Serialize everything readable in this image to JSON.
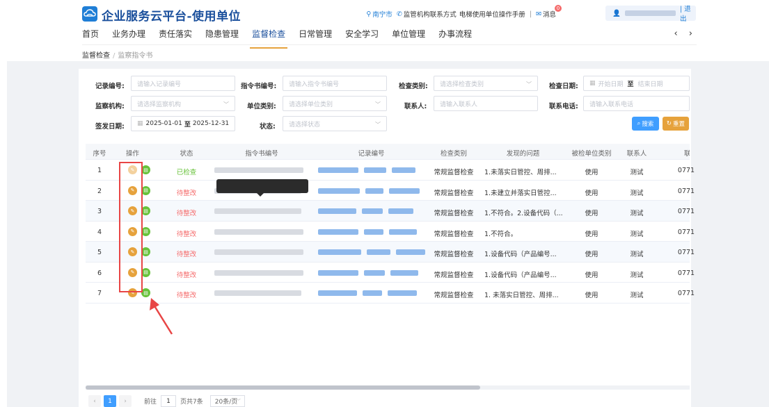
{
  "header": {
    "app_title": "企业服务云平台-使用单位",
    "location": "南宁市",
    "contact_link": "监管机构联系方式",
    "manual_link": "电梯使用单位操作手册",
    "separator": "|",
    "messages_label": "消息",
    "messages_count": "0",
    "logout_label": "| 退出"
  },
  "nav": {
    "items": [
      "首页",
      "业务办理",
      "责任落实",
      "隐患管理",
      "监督检查",
      "日常管理",
      "安全学习",
      "单位管理",
      "办事流程"
    ],
    "active_index": 4,
    "arrows": "‹ ›"
  },
  "breadcrumb": {
    "root": "监督检查",
    "separator": "/",
    "current": "监察指令书"
  },
  "filters": {
    "record_no_label": "记录编号:",
    "record_no_placeholder": "请输入记录编号",
    "order_no_label": "指令书编号:",
    "order_no_placeholder": "请输入指令书编号",
    "check_type_label": "检查类别:",
    "check_type_placeholder": "请选择检查类别",
    "check_date_label": "检查日期:",
    "check_date_start": "开始日期",
    "check_date_to": "至",
    "check_date_end": "结束日期",
    "agency_label": "监察机构:",
    "agency_placeholder": "请选择监察机构",
    "unit_type_label": "单位类别:",
    "unit_type_placeholder": "请选择单位类别",
    "contact_label": "联系人:",
    "contact_placeholder": "请输入联系人",
    "phone_label": "联系电话:",
    "phone_placeholder": "请输入联系电话",
    "issue_date_label": "签发日期:",
    "issue_date_start": "2025-01-01",
    "issue_date_to": "至",
    "issue_date_end": "2025-12-31",
    "status_label": "状态:",
    "status_placeholder": "请选择状态",
    "search_button": "搜索",
    "reset_button": "重置"
  },
  "table": {
    "columns": [
      "序号",
      "操作",
      "状态",
      "指令书编号",
      "记录编号",
      "检查类别",
      "发现的问题",
      "被检单位类别",
      "联系人",
      "联"
    ],
    "rows": [
      {
        "index": "1",
        "status": "已检查",
        "status_kind": "done",
        "check_type": "常规监督检查",
        "issue": "1.未落实日管控、周排...",
        "unit_type": "使用",
        "contact": "测试",
        "phone": "0771"
      },
      {
        "index": "2",
        "status": "待整改",
        "status_kind": "todo",
        "check_type": "常规监督检查",
        "issue": "1.未建立并落实日管控...",
        "unit_type": "使用",
        "contact": "测试",
        "phone": "0771"
      },
      {
        "index": "3",
        "status": "待整改",
        "status_kind": "todo",
        "check_type": "常规监督检查",
        "issue": "1.不符合。2.设备代码（...",
        "unit_type": "使用",
        "contact": "测试",
        "phone": "0771"
      },
      {
        "index": "4",
        "status": "待整改",
        "status_kind": "todo",
        "check_type": "常规监督检查",
        "issue": "1.不符合。",
        "unit_type": "使用",
        "contact": "测试",
        "phone": "0771"
      },
      {
        "index": "5",
        "status": "待整改",
        "status_kind": "todo",
        "check_type": "常规监督检查",
        "issue": "1.设备代码（产品编号...",
        "unit_type": "使用",
        "contact": "测试",
        "phone": "0771"
      },
      {
        "index": "6",
        "status": "待整改",
        "status_kind": "todo",
        "check_type": "常规监督检查",
        "issue": "1.设备代码（产品编号...",
        "unit_type": "使用",
        "contact": "测试",
        "phone": "0771"
      },
      {
        "index": "7",
        "status": "待整改",
        "status_kind": "todo",
        "check_type": "常规监督检查",
        "issue": "1. 未落实日管控、周排...",
        "unit_type": "使用",
        "contact": "测试",
        "phone": "0771"
      }
    ]
  },
  "pagination": {
    "current_page": "1",
    "goto_label": "前往",
    "goto_value": "1",
    "total_label": "页共7条",
    "page_size": "20条/页"
  },
  "colors": {
    "primary": "#409eff",
    "warning": "#e6a23c",
    "success": "#67c23a",
    "danger": "#f56c6c",
    "annotation": "#e84545"
  }
}
